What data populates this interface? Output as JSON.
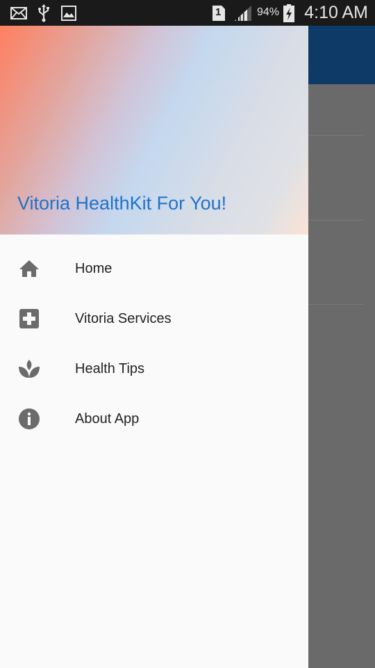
{
  "status_bar": {
    "time": "4:10 AM",
    "battery_percent": "94%",
    "sim_slot": "1",
    "icons": [
      "mail-icon",
      "usb-icon",
      "image-icon",
      "sim-icon",
      "signal-icon",
      "battery-charging-icon"
    ]
  },
  "drawer": {
    "header_title": "Vitoria HealthKit For You!",
    "items": [
      {
        "label": "Home",
        "icon": "home-icon"
      },
      {
        "label": "Vitoria Services",
        "icon": "medical-plus-icon"
      },
      {
        "label": "Health Tips",
        "icon": "spa-icon"
      },
      {
        "label": "About App",
        "icon": "info-icon"
      }
    ]
  },
  "colors": {
    "title_blue": "#1f73c9",
    "icon_gray": "#6b6b6b",
    "appbar_dark_blue": "#0d3a66",
    "scrim_gray": "#6a6a6a"
  }
}
